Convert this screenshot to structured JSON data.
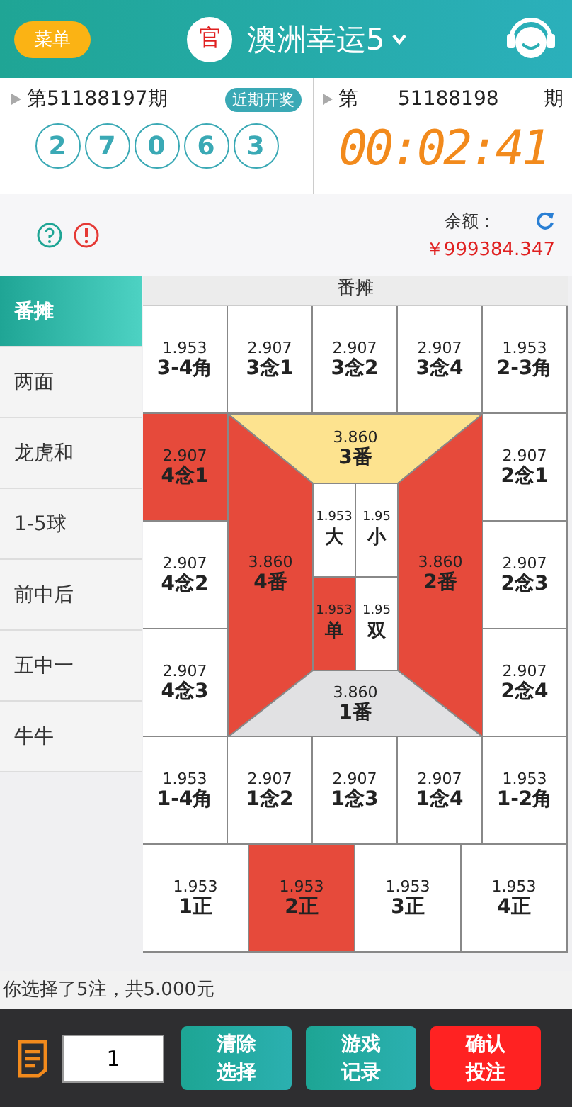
{
  "header": {
    "menu_button": "菜单",
    "badge": "官",
    "title": "澳洲幸运5"
  },
  "last_draw": {
    "issue": "第51188197期",
    "recent_button": "近期开奖",
    "balls": [
      "2",
      "7",
      "0",
      "6",
      "3"
    ]
  },
  "next_draw": {
    "prefix": "第",
    "issue": "51188198",
    "suffix": "期",
    "countdown": "00:02:41"
  },
  "balance": {
    "label": "余额：",
    "amount": "￥999384.347"
  },
  "sidebar": [
    {
      "label": "番摊",
      "selected": true
    },
    {
      "label": "两面",
      "selected": false
    },
    {
      "label": "龙虎和",
      "selected": false
    },
    {
      "label": "1-5球",
      "selected": false
    },
    {
      "label": "前中后",
      "selected": false
    },
    {
      "label": "五中一",
      "selected": false
    },
    {
      "label": "牛牛",
      "selected": false
    }
  ],
  "board": {
    "title": "番摊",
    "top_row": [
      {
        "odds": "1.953",
        "label": "3-4角",
        "selected": false
      },
      {
        "odds": "2.907",
        "label": "3念1",
        "selected": false
      },
      {
        "odds": "2.907",
        "label": "3念2",
        "selected": false
      },
      {
        "odds": "2.907",
        "label": "3念4",
        "selected": false
      },
      {
        "odds": "1.953",
        "label": "2-3角",
        "selected": false
      }
    ],
    "left_column": [
      {
        "odds": "2.907",
        "label": "4念1",
        "selected": true
      },
      {
        "odds": "2.907",
        "label": "4念2",
        "selected": false
      },
      {
        "odds": "2.907",
        "label": "4念3",
        "selected": false
      }
    ],
    "center": [
      {
        "kind": "top",
        "odds": "3.860",
        "label": "3番",
        "selected": false,
        "color": "#fde38f"
      },
      {
        "kind": "left",
        "odds": "3.860",
        "label": "4番",
        "selected": true
      },
      {
        "kind": "right",
        "odds": "3.860",
        "label": "2番",
        "selected": true
      },
      {
        "kind": "bottom",
        "odds": "3.860",
        "label": "1番",
        "selected": false,
        "color": "#e1e1e3"
      },
      {
        "kind": "cell",
        "odds": "1.953",
        "label": "大",
        "selected": false
      },
      {
        "kind": "cell",
        "odds": "1.95",
        "label": "小",
        "selected": false
      },
      {
        "kind": "cell",
        "odds": "1.953",
        "label": "单",
        "selected": true
      },
      {
        "kind": "cell",
        "odds": "1.95",
        "label": "双",
        "selected": false
      }
    ],
    "right_column": [
      {
        "odds": "2.907",
        "label": "2念1",
        "selected": false
      },
      {
        "odds": "2.907",
        "label": "2念3",
        "selected": false
      },
      {
        "odds": "2.907",
        "label": "2念4",
        "selected": false
      }
    ],
    "bottom_row": [
      {
        "odds": "1.953",
        "label": "1-4角",
        "selected": false
      },
      {
        "odds": "2.907",
        "label": "1念2",
        "selected": false
      },
      {
        "odds": "2.907",
        "label": "1念3",
        "selected": false
      },
      {
        "odds": "2.907",
        "label": "1念4",
        "selected": false
      },
      {
        "odds": "1.953",
        "label": "1-2角",
        "selected": false
      }
    ],
    "zheng_row": [
      {
        "odds": "1.953",
        "label": "1正",
        "selected": false
      },
      {
        "odds": "1.953",
        "label": "2正",
        "selected": true
      },
      {
        "odds": "1.953",
        "label": "3正",
        "selected": false
      },
      {
        "odds": "1.953",
        "label": "4正",
        "selected": false
      }
    ]
  },
  "summary": "你选择了5注，共5.000元",
  "footer": {
    "amount": "1",
    "buttons": [
      {
        "kind": "teal",
        "label": "清除选择"
      },
      {
        "kind": "teal",
        "label": "游戏记录"
      },
      {
        "kind": "red",
        "label": "确认投注"
      }
    ]
  }
}
